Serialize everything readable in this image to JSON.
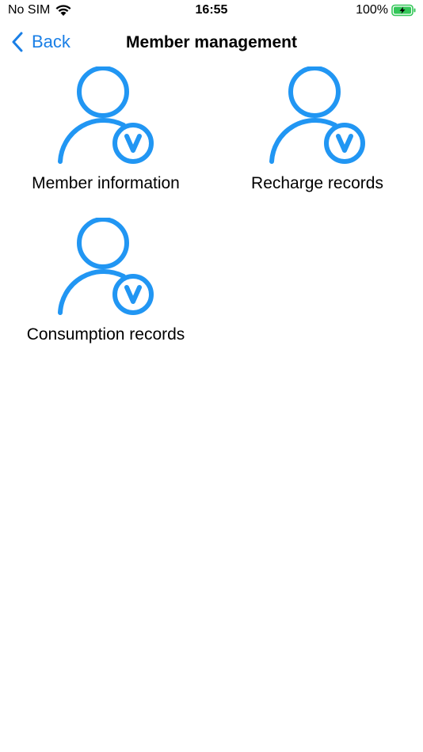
{
  "status_bar": {
    "carrier": "No SIM",
    "time": "16:55",
    "battery": "100%"
  },
  "nav": {
    "back_label": "Back",
    "title": "Member management"
  },
  "tiles": [
    {
      "label": "Member information",
      "icon": "member-icon"
    },
    {
      "label": "Recharge records",
      "icon": "member-icon"
    },
    {
      "label": "Consumption records",
      "icon": "member-icon"
    }
  ],
  "colors": {
    "accent": "#2196f3",
    "link": "#1a7fe6",
    "battery_fill": "#34c759"
  }
}
